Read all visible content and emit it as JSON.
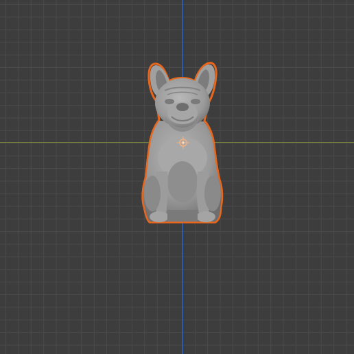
{
  "viewport": {
    "background_color": "#3d3d3d",
    "grid_color": "#4a4a4a",
    "x_axis_color": "#7a8a3c",
    "y_axis_color": "#3f6ab8"
  },
  "object": {
    "name": "french-bulldog-sculpture",
    "selected": true,
    "selection_outline_color": "#e8671c",
    "material_color": "#9c9c9c",
    "origin_marker_color": "#f0b080"
  }
}
